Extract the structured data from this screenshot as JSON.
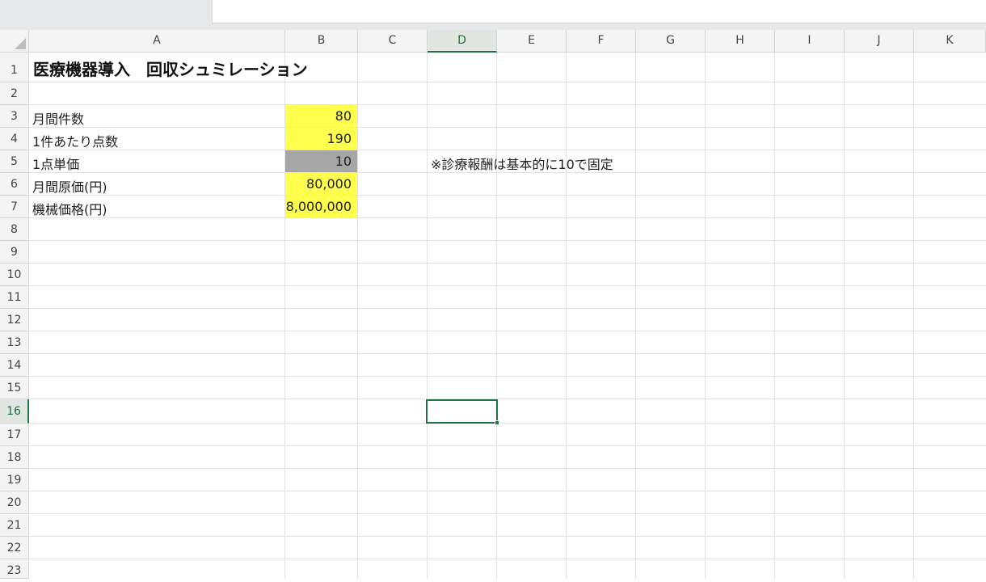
{
  "formula_bar": {
    "value": ""
  },
  "columns": [
    "A",
    "B",
    "C",
    "D",
    "E",
    "F",
    "G",
    "H",
    "I",
    "J",
    "K"
  ],
  "rows": [
    "1",
    "2",
    "3",
    "4",
    "5",
    "6",
    "7",
    "8",
    "9",
    "10",
    "11",
    "12",
    "13",
    "14",
    "15",
    "16",
    "17",
    "18",
    "19",
    "20",
    "21",
    "22",
    "23"
  ],
  "active_cell": "D16",
  "cells": {
    "A1": "医療機器導入　回収シュミレーション",
    "A3": "月間件数",
    "A4": "1件あたり点数",
    "A5": "1点単価",
    "A6": "月間原価(円)",
    "A7": "機械価格(円)",
    "B3": "80",
    "B4": "190",
    "B5": "10",
    "B6": "80,000",
    "B7": "8,000,000",
    "D5": "※診療報酬は基本的に10で固定"
  },
  "colors": {
    "input_fill": "#ffff4d",
    "fixed_fill": "#a6a6a6",
    "accent": "#217346"
  }
}
